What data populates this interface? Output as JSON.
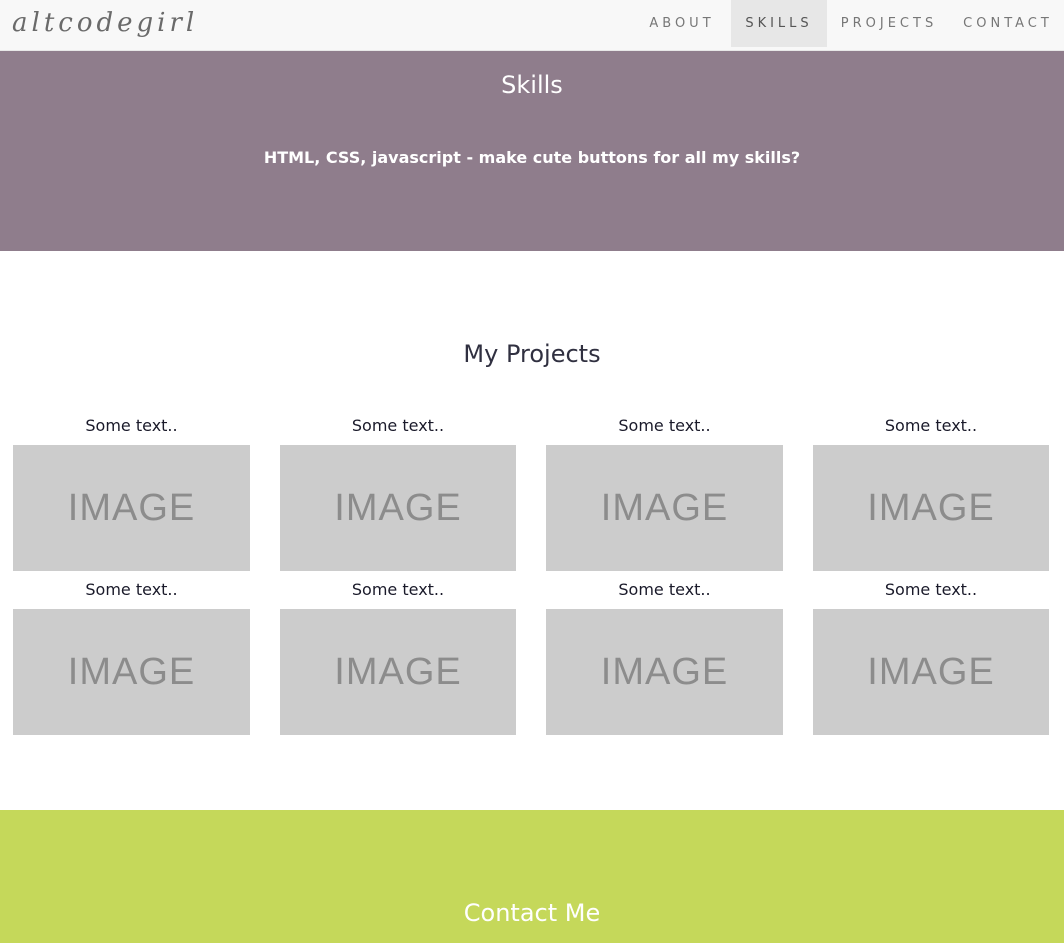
{
  "navbar": {
    "brand": "altcodegirl",
    "items": [
      {
        "label": "ABOUT",
        "active": false
      },
      {
        "label": "SKILLS",
        "active": true
      },
      {
        "label": "PROJECTS",
        "active": false
      },
      {
        "label": "CONTACT",
        "active": false
      }
    ]
  },
  "skills": {
    "title": "Skills",
    "text": "HTML, CSS, javascript - make cute buttons for all my skills?"
  },
  "projects": {
    "title": "My Projects",
    "items": [
      {
        "caption": "Some text..",
        "image_label": "IMAGE"
      },
      {
        "caption": "Some text..",
        "image_label": "IMAGE"
      },
      {
        "caption": "Some text..",
        "image_label": "IMAGE"
      },
      {
        "caption": "Some text..",
        "image_label": "IMAGE"
      },
      {
        "caption": "Some text..",
        "image_label": "IMAGE"
      },
      {
        "caption": "Some text..",
        "image_label": "IMAGE"
      },
      {
        "caption": "Some text..",
        "image_label": "IMAGE"
      },
      {
        "caption": "Some text..",
        "image_label": "IMAGE"
      }
    ]
  },
  "contact": {
    "title": "Contact Me"
  },
  "colors": {
    "skills_bg": "#8f7d8c",
    "contact_bg": "#c5d85a",
    "image_placeholder": "#cccccc"
  }
}
